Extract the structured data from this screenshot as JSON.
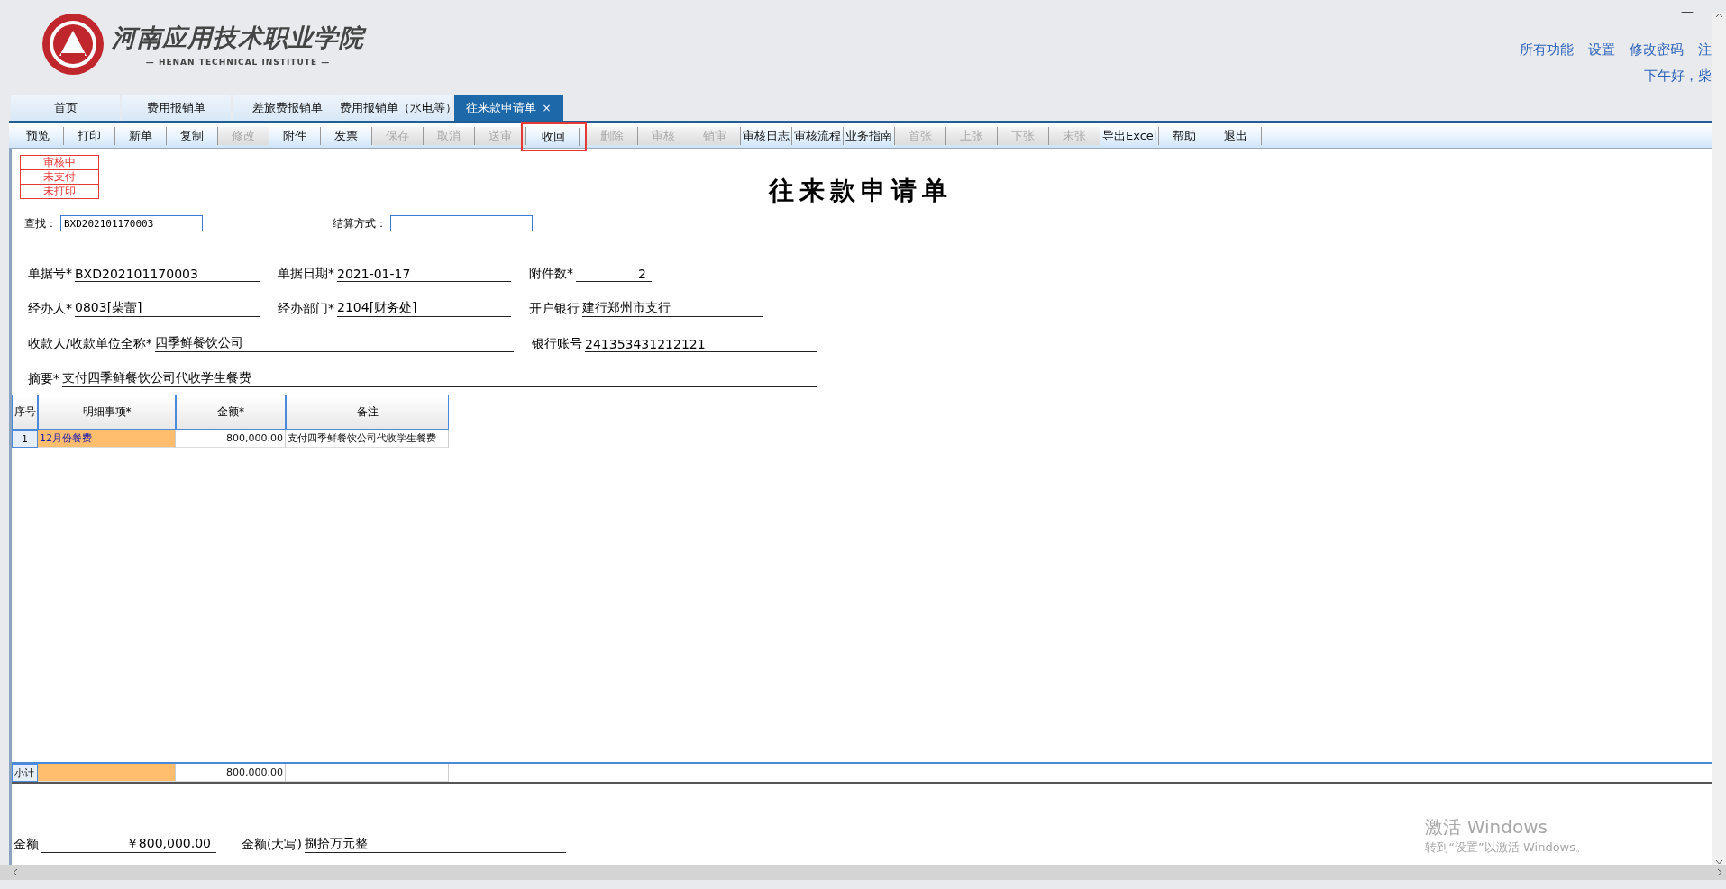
{
  "header": {
    "logo_title": "河南应用技术职业学院",
    "logo_subtitle": "— HENAN TECHNICAL INSTITUTE —",
    "links": [
      "所有功能",
      "设置",
      "修改密码",
      "注"
    ],
    "greeting": "下午好，柴",
    "minimize": "—"
  },
  "tabs": [
    {
      "label": "首页",
      "selected": false
    },
    {
      "label": "费用报销单",
      "selected": false
    },
    {
      "label": "差旅费报销单",
      "selected": false
    },
    {
      "label": "费用报销单（水电等）",
      "selected": false
    },
    {
      "label": "往来款申请单",
      "selected": true,
      "close": "×"
    }
  ],
  "toolbar": [
    {
      "label": "预览",
      "disabled": false,
      "highlighted": false
    },
    {
      "label": "打印",
      "disabled": false,
      "highlighted": false
    },
    {
      "label": "新单",
      "disabled": false,
      "highlighted": false
    },
    {
      "label": "复制",
      "disabled": false,
      "highlighted": false
    },
    {
      "label": "修改",
      "disabled": true,
      "highlighted": false
    },
    {
      "label": "附件",
      "disabled": false,
      "highlighted": false
    },
    {
      "label": "发票",
      "disabled": false,
      "highlighted": false
    },
    {
      "label": "保存",
      "disabled": true,
      "highlighted": false
    },
    {
      "label": "取消",
      "disabled": true,
      "highlighted": false
    },
    {
      "label": "送审",
      "disabled": true,
      "highlighted": false
    },
    {
      "label": "收回",
      "disabled": false,
      "highlighted": true
    },
    {
      "label": "删除",
      "disabled": true,
      "highlighted": false
    },
    {
      "label": "审核",
      "disabled": true,
      "highlighted": false
    },
    {
      "label": "销审",
      "disabled": true,
      "highlighted": false
    },
    {
      "label": "审核日志",
      "disabled": false,
      "highlighted": false
    },
    {
      "label": "审核流程",
      "disabled": false,
      "highlighted": false
    },
    {
      "label": "业务指南",
      "disabled": false,
      "highlighted": false
    },
    {
      "label": "首张",
      "disabled": true,
      "highlighted": false
    },
    {
      "label": "上张",
      "disabled": true,
      "highlighted": false
    },
    {
      "label": "下张",
      "disabled": true,
      "highlighted": false
    },
    {
      "label": "末张",
      "disabled": true,
      "highlighted": false
    },
    {
      "label": "导出Excel",
      "disabled": false,
      "highlighted": false
    },
    {
      "label": "帮助",
      "disabled": false,
      "highlighted": false
    },
    {
      "label": "退出",
      "disabled": false,
      "highlighted": false
    }
  ],
  "status_stamps": [
    "审核中",
    "未支付",
    "未打印"
  ],
  "form_title": "往来款申请单",
  "search": [
    {
      "label": "查找：",
      "value": "BXD202101170003"
    },
    {
      "label": "结算方式："
    }
  ],
  "fields": [
    [
      {
        "label": "单据号*",
        "value": "BXD202101170003"
      },
      {
        "label": "单据日期*",
        "value": "2021-01-17"
      },
      {
        "label": "附件数*",
        "value": "2",
        "kind": "count"
      }
    ],
    [
      {
        "label": "经办人*",
        "value": "0803[柴蕾]"
      },
      {
        "label": "经办部门*",
        "value": "2104[财务处]"
      },
      {
        "label": "开户银行",
        "value": "建行郑州市支行"
      }
    ],
    [
      {
        "label": "收款人/收款单位全称*",
        "value": "四季鲜餐饮公司"
      },
      {
        "label": "银行账号",
        "value": "241353431212121"
      }
    ],
    [
      {
        "label": "摘要*",
        "value": "支付四季鲜餐饮公司代收学生餐费"
      }
    ]
  ],
  "table": {
    "columns": [
      "序号",
      "明细事项*",
      "金额*",
      "备注"
    ],
    "rows": [
      [
        "1",
        "12月份餐费",
        "800,000.00",
        "支付四季鲜餐饮公司代收学生餐费"
      ]
    ],
    "subtotal": {
      "label": "小计",
      "amount": "800,000.00"
    }
  },
  "totals": [
    {
      "label": "金额",
      "value": "￥800,000.00"
    },
    {
      "label": "金额(大写)",
      "value": "捌拾万元整"
    }
  ],
  "activation_notice": {
    "title": "激活 Windows",
    "text": "转到“设置”以激活 Windows。"
  }
}
